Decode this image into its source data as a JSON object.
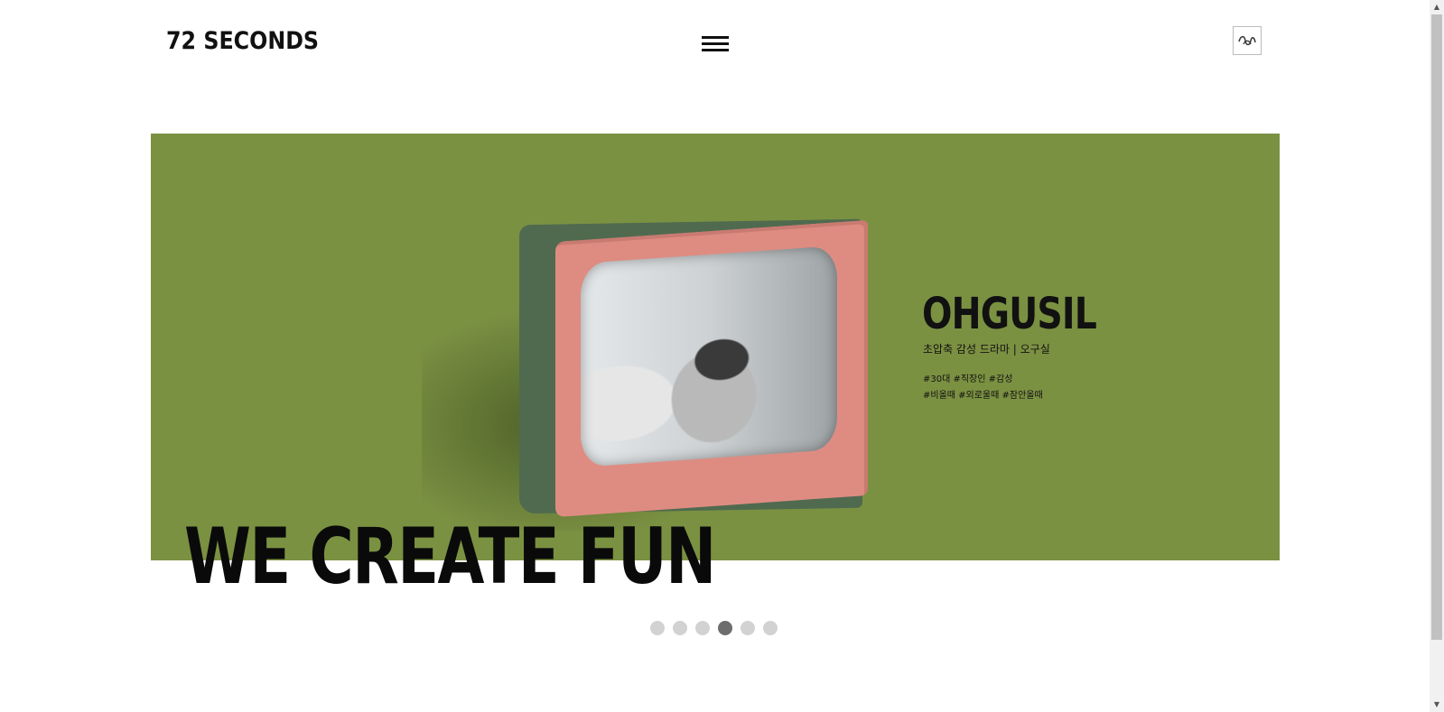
{
  "header": {
    "logo": "72 SECONDS",
    "menu_icon": "hamburger-menu-icon",
    "brand_icon": "squiggle-logo-icon"
  },
  "hero": {
    "background_color": "#7b9142",
    "show_title": "OHGUSIL",
    "show_subtitle": "초압축 감성 드라마  |  오구실",
    "tags_line1": "#30대 #직장인 #감성",
    "tags_line2": "#비올때 #외로울때 #잠안올때",
    "headline": "WE CREATE FUN"
  },
  "carousel": {
    "slides": 6,
    "active_index": 3
  },
  "colors": {
    "tv_front": "#de8c82",
    "tv_back": "#4f6a4f",
    "dot": "#d2d2d2",
    "dot_active": "#6d6d6d"
  }
}
